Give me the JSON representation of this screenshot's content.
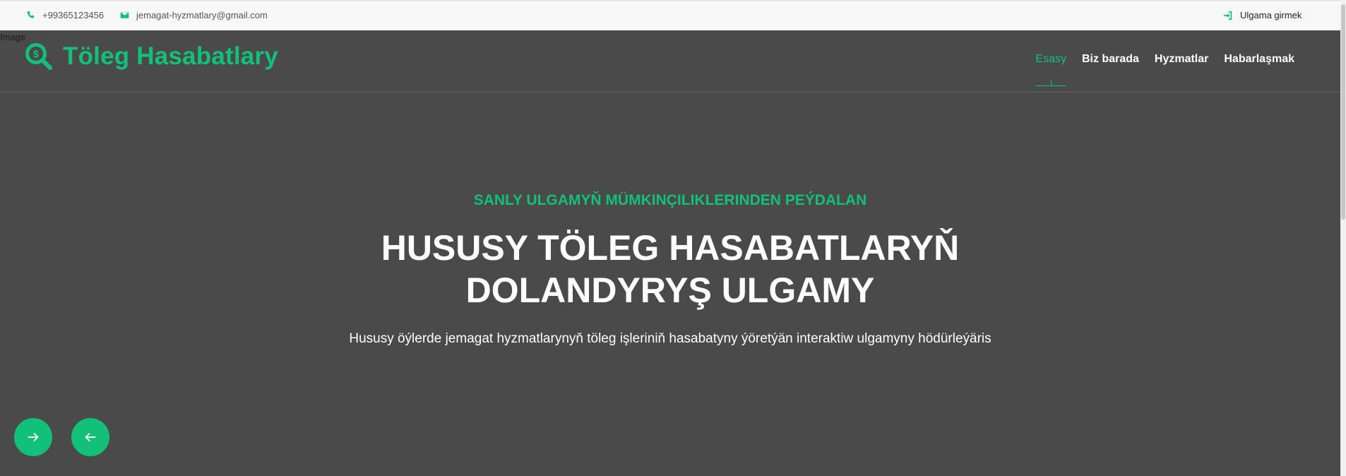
{
  "topbar": {
    "phone": "+99365123456",
    "email": "jemagat-hyzmatlary@gmail.com",
    "login": "Ulgama girmek"
  },
  "broken_image_alt": "Image",
  "header": {
    "logo_text": "Töleg Hasabatlary",
    "nav": [
      "Esasy",
      "Biz barada",
      "Hyzmatlar",
      "Habarlaşmak"
    ],
    "active_nav": "Esasy"
  },
  "hero": {
    "subtitle": "SANLY ULGAMYŇ MÜMKINÇILIKLERINDEN PEÝDALAN",
    "title": "HUSUSY TÖLEG HASABATLARYŇ DOLANDYRYŞ ULGAMY",
    "description": "Hususy öýlerde jemagat hyzmatlarynyň töleg işleriniň hasabatyny ýöretýän interaktiw ulgamyny hödürleýäris"
  },
  "icons": {
    "phone": "phone-icon",
    "email": "envelope-icon",
    "login": "sign-in-icon",
    "logo": "search-dollar-icon",
    "next": "arrow-right-icon",
    "prev": "arrow-left-icon"
  },
  "colors": {
    "accent": "#13c07a",
    "background": "#4a4a4a",
    "topbar": "#f8f8f8"
  }
}
